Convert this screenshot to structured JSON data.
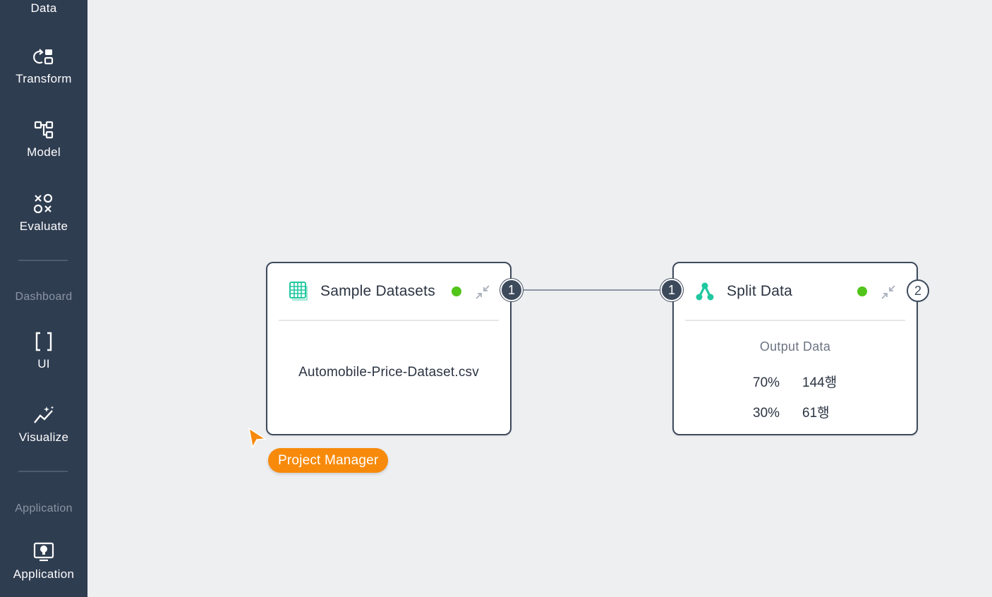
{
  "sidebar": {
    "items": [
      {
        "label": "Data",
        "icon": "data-icon"
      },
      {
        "label": "Transform",
        "icon": "transform-icon"
      },
      {
        "label": "Model",
        "icon": "model-icon"
      },
      {
        "label": "Evaluate",
        "icon": "evaluate-icon"
      },
      {
        "label": "UI",
        "icon": "brackets-icon"
      },
      {
        "label": "Visualize",
        "icon": "visualize-icon"
      },
      {
        "label": "Application",
        "icon": "application-icon"
      }
    ],
    "sections": {
      "dashboard": "Dashboard",
      "application": "Application"
    }
  },
  "nodes": {
    "sample": {
      "title": "Sample Datasets",
      "icon": "grid-table-icon",
      "file": "Automobile-Price-Dataset.csv",
      "output_port": "1"
    },
    "split": {
      "title": "Split Data",
      "icon": "split-branch-icon",
      "input_port": "1",
      "output_port": "2",
      "output_title": "Output Data",
      "rows": [
        {
          "pct": "70%",
          "count": "144행"
        },
        {
          "pct": "30%",
          "count": "61행"
        }
      ]
    }
  },
  "collaborator": {
    "name": "Project Manager",
    "color": "#f78a0b"
  },
  "colors": {
    "sidebar_bg": "#2f3d51",
    "node_border": "#3d4a5c",
    "status_ok": "#52c41a",
    "accent_teal": "#1fc8a0"
  }
}
